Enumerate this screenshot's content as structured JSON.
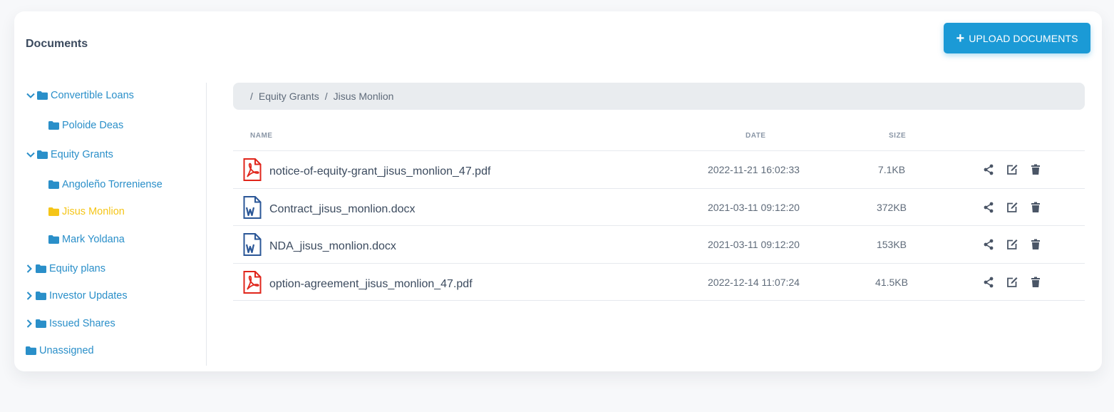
{
  "page": {
    "title": "Documents"
  },
  "upload_button": {
    "icon": "plus-icon",
    "label": "UPLOAD DOCUMENTS"
  },
  "colors": {
    "accent": "#1b9ad6",
    "link": "#2a8fc9",
    "active": "#f5c518",
    "pdf": "#e0251b",
    "docx": "#2b5797"
  },
  "tree": [
    {
      "label": "Convertible Loans",
      "expanded": true,
      "level": 0
    },
    {
      "label": "Poloide Deas",
      "level": 1
    },
    {
      "label": "Equity Grants",
      "expanded": true,
      "level": 0
    },
    {
      "label": "Angoleño Torreniense",
      "level": 1
    },
    {
      "label": "Jisus Monlion",
      "level": 1,
      "active": true
    },
    {
      "label": "Mark Yoldana",
      "level": 1
    },
    {
      "label": "Equity plans",
      "expanded": false,
      "level": 0
    },
    {
      "label": "Investor Updates",
      "expanded": false,
      "level": 0
    },
    {
      "label": "Issued Shares",
      "expanded": false,
      "level": 0
    },
    {
      "label": "Unassigned",
      "level": 0
    }
  ],
  "breadcrumb": {
    "separator": "/",
    "items": [
      "Equity Grants",
      "Jisus Monlion"
    ]
  },
  "table": {
    "columns": {
      "name": "NAME",
      "date": "DATE",
      "size": "SIZE"
    },
    "rows": [
      {
        "name": "notice-of-equity-grant_jisus_monlion_47.pdf",
        "date": "2022-11-21 16:02:33",
        "size": "7.1KB",
        "type": "pdf"
      },
      {
        "name": "Contract_jisus_monlion.docx",
        "date": "2021-03-11 09:12:20",
        "size": "372KB",
        "type": "docx"
      },
      {
        "name": "NDA_jisus_monlion.docx",
        "date": "2021-03-11 09:12:20",
        "size": "153KB",
        "type": "docx"
      },
      {
        "name": "option-agreement_jisus_monlion_47.pdf",
        "date": "2022-12-14 11:07:24",
        "size": "41.5KB",
        "type": "pdf"
      }
    ],
    "row_actions": [
      "share-icon",
      "edit-icon",
      "trash-icon"
    ]
  }
}
